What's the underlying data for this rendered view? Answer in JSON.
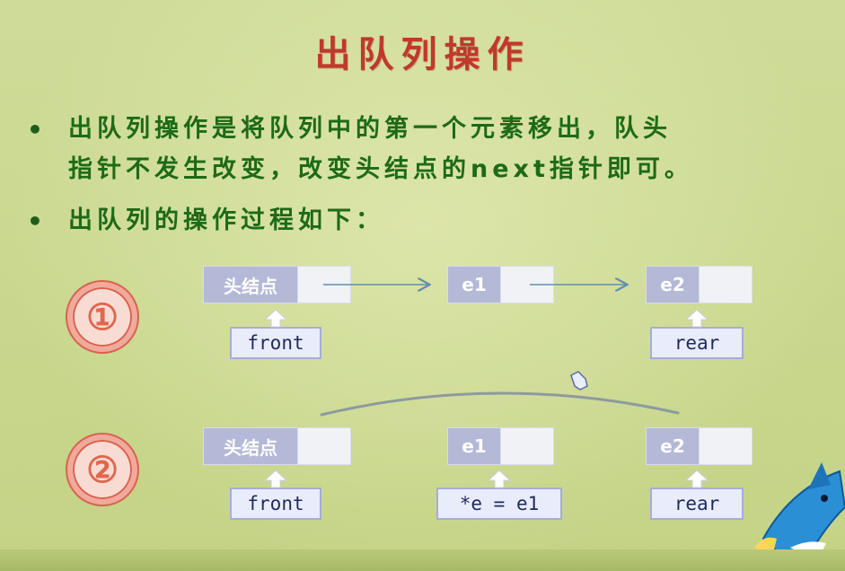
{
  "title": "出队列操作",
  "bullets": [
    {
      "marker": "•",
      "lines": [
        "出队列操作是将队列中的第一个元素移出，队头",
        "指针不发生改变，改变头结点的next指针即可。"
      ]
    },
    {
      "marker": "•",
      "lines": [
        "出队列的操作过程如下："
      ]
    }
  ],
  "steps": [
    {
      "number": "①",
      "nodes": [
        "头结点",
        "e1",
        "e2"
      ],
      "pointers": [
        "front",
        "rear"
      ]
    },
    {
      "number": "②",
      "nodes": [
        "头结点",
        "e1",
        "e2"
      ],
      "pointers": [
        "front",
        "*e = e1",
        "rear"
      ]
    }
  ],
  "colors": {
    "title": "#c0392b",
    "text": "#1d6a17",
    "node_data": "#b3b9d6",
    "pointer_box": "#e9ecfb",
    "arrow": "#5f8fb0"
  }
}
